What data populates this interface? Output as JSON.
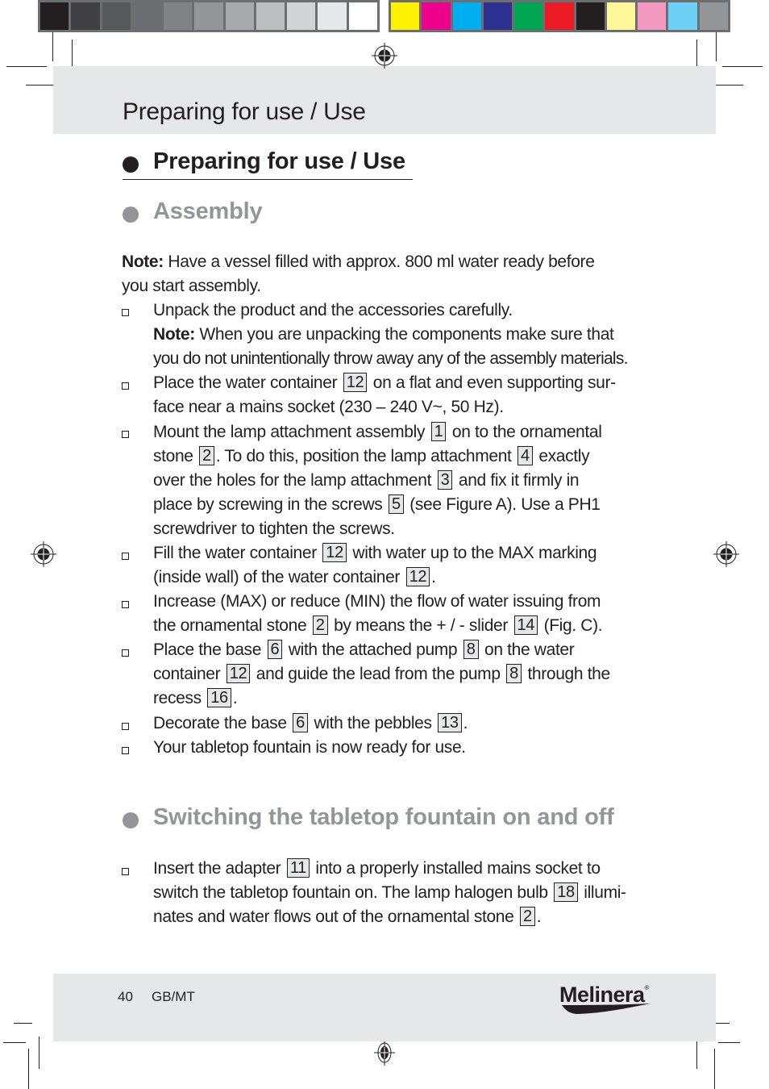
{
  "print_marks": {
    "gray_swatches": [
      "#231f20",
      "#414042",
      "#58595b",
      "#6d6e71",
      "#808285",
      "#939598",
      "#a7a9ac",
      "#bcbec0",
      "#d1d3d4",
      "#e6e7e8",
      "#ffffff"
    ],
    "color_swatches": [
      "#fff200",
      "#ec008c",
      "#00aeef",
      "#2e3192",
      "#00a651",
      "#ed1c24",
      "#231f20",
      "#fff799",
      "#f49ac1",
      "#6dcff6",
      "#939598"
    ]
  },
  "header": {
    "title": "Preparing for use / Use"
  },
  "sections": {
    "main_heading": "Preparing for use / Use",
    "assembly_heading": "Assembly",
    "switching_heading": "Switching the tabletop fountain on and off"
  },
  "assembly": {
    "note_label": "Note:",
    "note_line1": " Have a vessel filled with approx. 800 ml water ready before",
    "note_line2": "you start assembly.",
    "item1_line1": "Unpack the product and the accessories carefully.",
    "item1_note_label": "Note:",
    "item1_note_line1": " When you are unpacking the components make sure that",
    "item1_note_line2": "you do not unintentionally throw away any of the assembly materials.",
    "item2_a": "Place the water container",
    "item2_ref1": "12",
    "item2_b": "on a flat and even supporting sur-",
    "item2_line2": "face near a mains socket (230 – 240 V~, 50 Hz).",
    "item3_a": "Mount the lamp attachment assembly",
    "item3_ref1": "1",
    "item3_b": "on to the ornamental",
    "item3_c": "stone",
    "item3_ref2": "2",
    "item3_d": ". To do this, position the lamp attachment",
    "item3_ref3": "4",
    "item3_e": "exactly",
    "item3_f": "over the holes for the lamp attachment",
    "item3_ref4": "3",
    "item3_g": "and fix it firmly in",
    "item3_h": "place by screwing in the screws",
    "item3_ref5": "5",
    "item3_i": "(see Figure A). Use a PH1",
    "item3_j": "screwdriver to tighten the screws.",
    "item4_a": "Fill the water container",
    "item4_ref1": "12",
    "item4_b": "with water up to the MAX marking",
    "item4_c": "(inside wall) of the water container",
    "item4_ref2": "12",
    "item4_d": ".",
    "item5_a": "Increase (MAX) or reduce (MIN) the flow of water issuing from",
    "item5_b": "the ornamental stone",
    "item5_ref1": "2",
    "item5_c": "by means the + / - slider",
    "item5_ref2": "14",
    "item5_d": "(Fig. C).",
    "item6_a": "Place the base",
    "item6_ref1": "6",
    "item6_b": "with the attached pump",
    "item6_ref2": "8",
    "item6_c": "on the water",
    "item6_d": "container",
    "item6_ref3": "12",
    "item6_e": "and guide the lead from the pump",
    "item6_ref4": "8",
    "item6_f": "through the",
    "item6_g": "recess",
    "item6_ref5": "16",
    "item6_h": ".",
    "item7_a": "Decorate the base",
    "item7_ref1": "6",
    "item7_b": "with the pebbles",
    "item7_ref2": "13",
    "item7_c": ".",
    "item8": "Your tabletop fountain is now ready for use."
  },
  "switching": {
    "item1_a": "Insert the adapter",
    "item1_ref1": "11",
    "item1_b": "into a properly installed mains socket to",
    "item1_c": "switch the tabletop fountain on. The lamp halogen bulb",
    "item1_ref2": "18",
    "item1_d": "illumi-",
    "item1_e": "nates and water flows out of the ornamental stone",
    "item1_ref3": "2",
    "item1_f": "."
  },
  "footer": {
    "page_number": "40",
    "language": "GB/MT",
    "brand": "Melinera",
    "brand_mark": "®"
  }
}
